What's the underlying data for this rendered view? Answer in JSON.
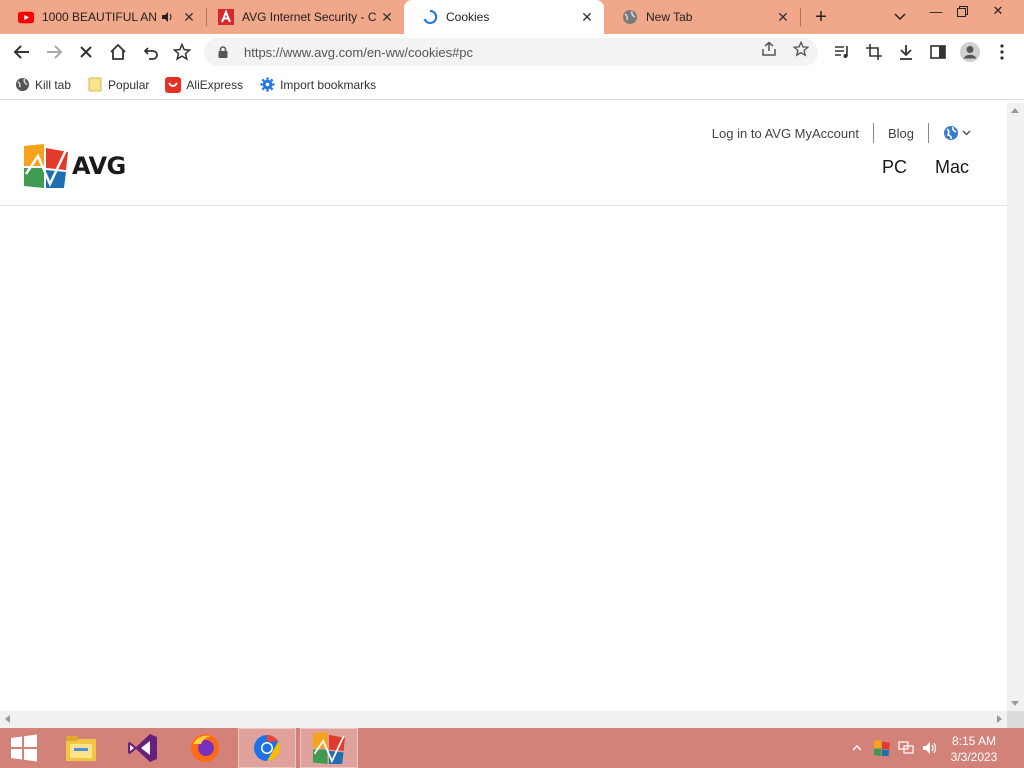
{
  "browser": {
    "tabs": [
      {
        "title": "1000 BEAUTIFUL AN",
        "favicon": "youtube-icon",
        "audio": true,
        "active": false
      },
      {
        "title": "AVG Internet Security - C",
        "favicon": "avg-page-icon",
        "active": false
      },
      {
        "title": "Cookies",
        "favicon": "loading-spinner-icon",
        "active": true
      },
      {
        "title": "New Tab",
        "favicon": "globe-icon",
        "active": false
      }
    ],
    "url": "https://www.avg.com/en-ww/cookies#pc",
    "bookmarks": [
      {
        "label": "Kill tab",
        "icon": "globe-icon"
      },
      {
        "label": "Popular",
        "icon": "folder-icon"
      },
      {
        "label": "AliExpress",
        "icon": "aliexpress-icon"
      },
      {
        "label": "Import bookmarks",
        "icon": "gear-icon"
      }
    ]
  },
  "site": {
    "logo_text": "AVG",
    "util_nav": {
      "login": "Log in to AVG MyAccount",
      "blog": "Blog"
    },
    "main_nav": [
      "PC",
      "Mac"
    ]
  },
  "taskbar": {
    "apps": [
      "start",
      "file-explorer",
      "visual-studio",
      "firefox",
      "chrome",
      "avg"
    ],
    "clock": {
      "time": "8:15 AM",
      "date": "3/3/2023"
    }
  },
  "colors": {
    "tabstrip": "#f0a78a",
    "taskbar": "#d3827a",
    "avg_orange": "#ff6a13",
    "avg_green": "#4caf50"
  }
}
